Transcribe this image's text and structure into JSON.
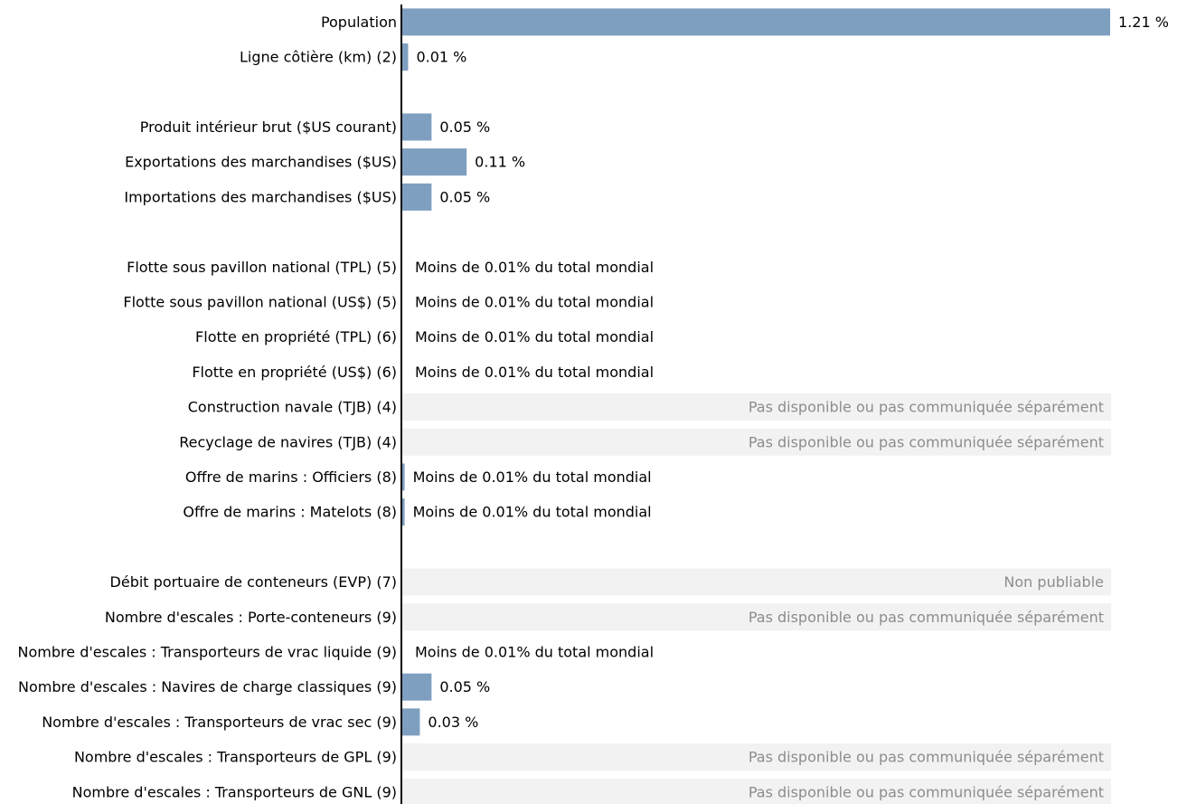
{
  "chart_data": {
    "type": "bar",
    "orientation": "horizontal",
    "title": "",
    "xlabel": "",
    "ylabel": "",
    "xlim": [
      0,
      1.21
    ],
    "unit": "%",
    "grid": false,
    "colors": {
      "bar": "#7f9fc0",
      "axis": "#000000",
      "na_band": "#f2f2f2",
      "na_text": "#8c8c8c"
    },
    "categories": [
      "Population",
      "Ligne côtière (km) (2)",
      "",
      "Produit intérieur brut ($US courant)",
      "Exportations des marchandises ($US)",
      "Importations des marchandises ($US)",
      "",
      "Flotte sous pavillon national (TPL) (5)",
      "Flotte sous pavillon national (US$) (5)",
      "Flotte en propriété (TPL) (6)",
      "Flotte en propriété (US$) (6)",
      "Construction navale (TJB) (4)",
      "Recyclage de navires (TJB) (4)",
      "Offre de marins : Officiers (8)",
      "Offre de marins : Matelots (8)",
      "",
      "Débit portuaire de conteneurs (EVP) (7)",
      "Nombre d'escales : Porte-conteneurs (9)",
      "Nombre d'escales : Transporteurs de vrac liquide (9)",
      "Nombre d'escales : Navires de charge classiques (9)",
      "Nombre d'escales : Transporteurs de vrac sec (9)",
      "Nombre d'escales : Transporteurs de GPL (9)",
      "Nombre d'escales : Transporteurs de GNL (9)"
    ],
    "values": [
      1.21,
      0.01,
      null,
      0.05,
      0.11,
      0.05,
      null,
      0.0,
      0.0,
      0.0,
      0.0,
      null,
      null,
      0.004,
      0.004,
      null,
      null,
      null,
      0.0,
      0.05,
      0.03,
      null,
      null
    ],
    "data_labels": [
      "1.21 %",
      "0.01 %",
      "",
      "0.05 %",
      "0.11 %",
      "0.05 %",
      "",
      "Moins de 0.01% du total mondial",
      "Moins de 0.01% du total mondial",
      "Moins de 0.01% du total mondial",
      "Moins de 0.01% du total mondial",
      "Pas disponible ou pas communiquée séparément",
      "Pas disponible ou pas communiquée séparément",
      "Moins de 0.01% du total mondial",
      "Moins de 0.01% du total mondial",
      "",
      "Non publiable",
      "Pas disponible ou pas communiquée séparément",
      "Moins de 0.01% du total mondial",
      "0.05 %",
      "0.03 %",
      "Pas disponible ou pas communiquée séparément",
      "Pas disponible ou pas communiquée séparément"
    ],
    "status": [
      "value",
      "value",
      "gap",
      "value",
      "value",
      "value",
      "gap",
      "small",
      "small",
      "small",
      "small",
      "na",
      "na",
      "small",
      "small",
      "gap",
      "na",
      "na",
      "small",
      "value",
      "value",
      "na",
      "na"
    ]
  }
}
